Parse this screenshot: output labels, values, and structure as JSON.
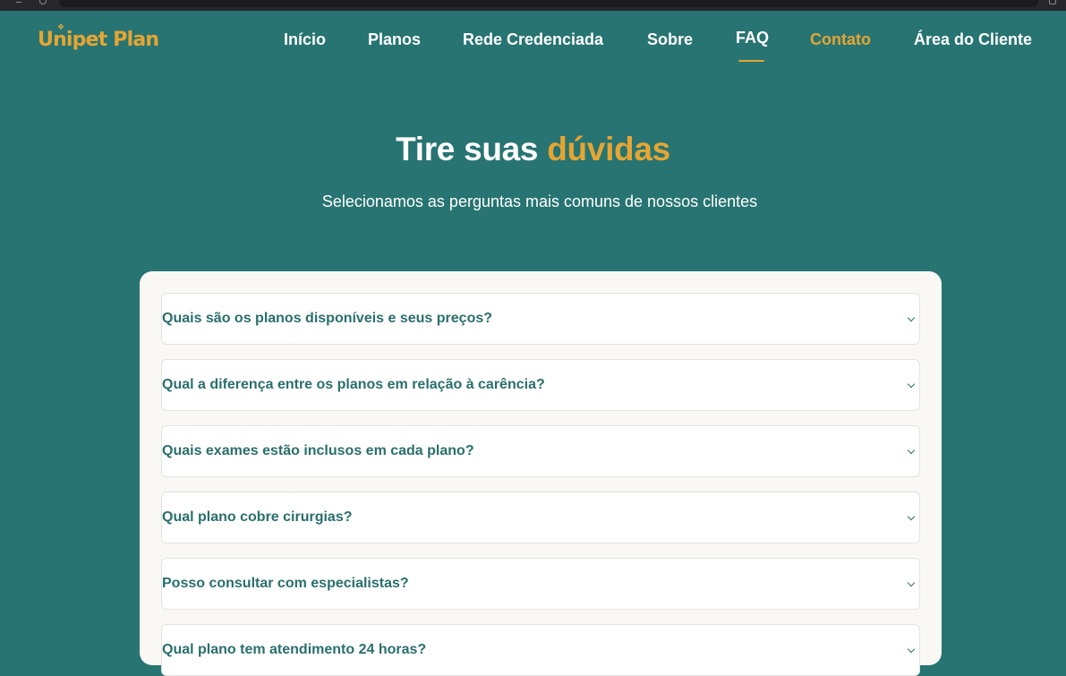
{
  "brand": {
    "name": "Unipet Plan",
    "color": "#e6a532"
  },
  "nav": {
    "items": [
      {
        "label": "Início"
      },
      {
        "label": "Planos"
      },
      {
        "label": "Rede Credenciada"
      },
      {
        "label": "Sobre"
      },
      {
        "label": "FAQ",
        "active": true
      },
      {
        "label": "Contato",
        "highlight": true
      },
      {
        "label": "Área do Cliente"
      }
    ]
  },
  "hero": {
    "title_prefix": "Tire suas",
    "title_accent": "dúvidas",
    "subtitle": "Selecionamos as perguntas mais comuns de nossos clientes"
  },
  "faq": {
    "items": [
      {
        "question": "Quais são os planos disponíveis e seus preços?"
      },
      {
        "question": "Qual a diferença entre os planos em relação à carência?"
      },
      {
        "question": "Quais exames estão inclusos em cada plano?"
      },
      {
        "question": "Qual plano cobre cirurgias?"
      },
      {
        "question": "Posso consultar com especialistas?"
      },
      {
        "question": "Qual plano tem atendimento 24 horas?"
      }
    ]
  },
  "colors": {
    "background": "#277472",
    "accent": "#e6a532",
    "card": "#f9f8f5",
    "question_text": "#2a6f6c"
  }
}
